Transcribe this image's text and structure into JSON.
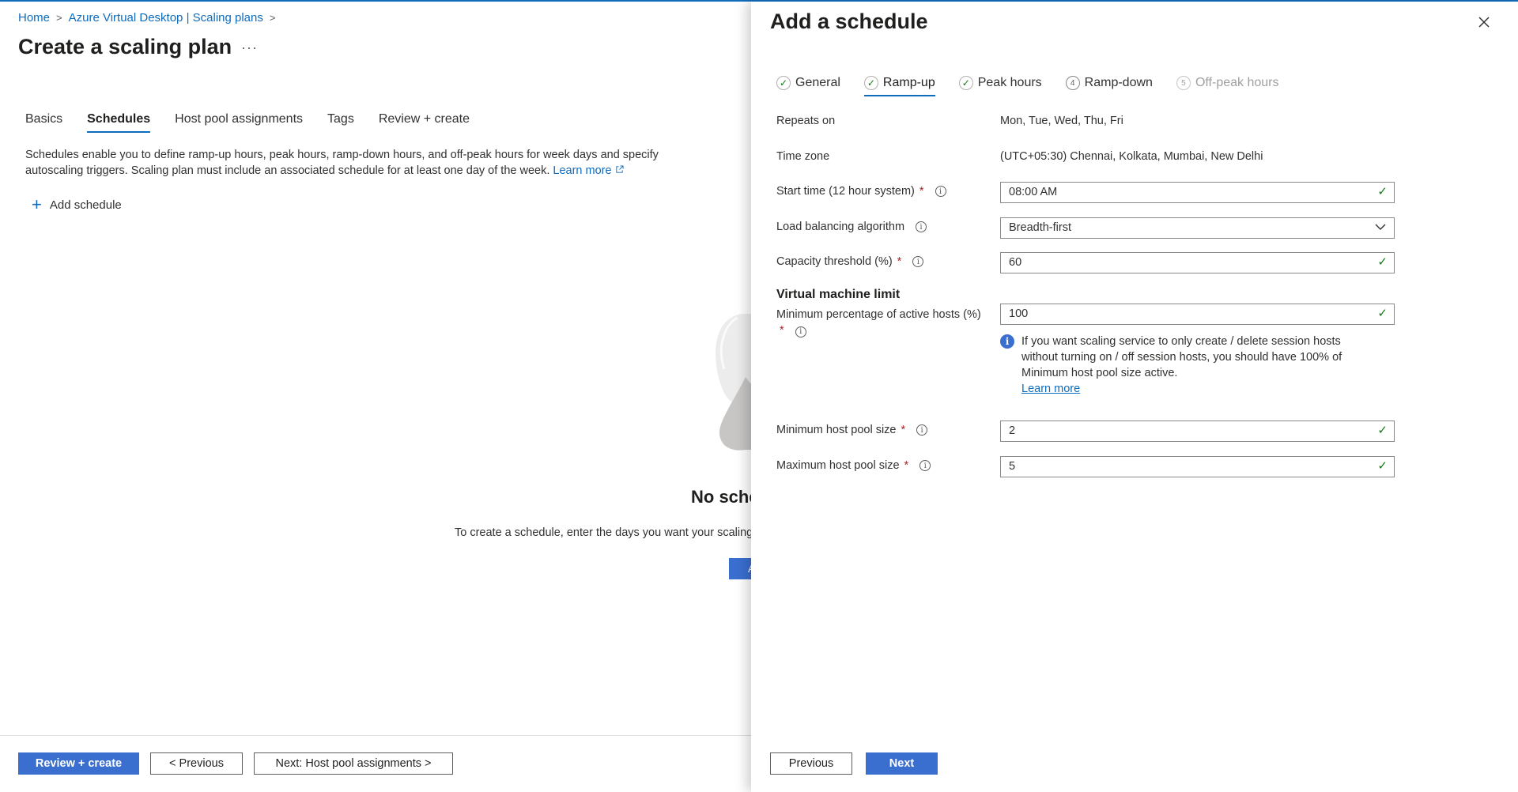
{
  "breadcrumb": {
    "home": "Home",
    "parent": "Azure Virtual Desktop | Scaling plans",
    "separator": ">"
  },
  "page": {
    "title": "Create a scaling plan",
    "more_label": "···",
    "tabs": [
      "Basics",
      "Schedules",
      "Host pool assignments",
      "Tags",
      "Review + create"
    ],
    "active_tab": "Schedules",
    "description": "Schedules enable you to define ramp-up hours, peak hours, ramp-down hours, and off-peak hours for week days and specify autoscaling triggers. Scaling plan must include an associated schedule for at least one day of the week.",
    "learn_more": "Learn more",
    "add_schedule": "Add schedule",
    "empty_title": "No sche",
    "empty_desc": "To create a schedule, enter the days you want your scaling",
    "empty_button": "A"
  },
  "footer": {
    "review_create": "Review + create",
    "previous": "< Previous",
    "next": "Next: Host pool assignments >"
  },
  "panel": {
    "title": "Add a schedule",
    "steps": [
      {
        "label": "General",
        "state": "done",
        "marker": "✓"
      },
      {
        "label": "Ramp-up",
        "state": "active",
        "marker": "✓"
      },
      {
        "label": "Peak hours",
        "state": "done",
        "marker": "✓"
      },
      {
        "label": "Ramp-down",
        "state": "todo",
        "marker": "4"
      },
      {
        "label": "Off-peak hours",
        "state": "disabled",
        "marker": "5"
      }
    ],
    "repeats_on_label": "Repeats on",
    "repeats_on_value": "Mon, Tue, Wed, Thu, Fri",
    "time_zone_label": "Time zone",
    "time_zone_value": "(UTC+05:30) Chennai, Kolkata, Mumbai, New Delhi",
    "start_time_label": "Start time (12 hour system)",
    "start_time_value": "08:00 AM",
    "load_balancing_label": "Load balancing algorithm",
    "load_balancing_value": "Breadth-first",
    "capacity_label": "Capacity threshold (%)",
    "capacity_value": "60",
    "vm_limit_heading": "Virtual machine limit",
    "min_active_label": "Minimum percentage of active hosts (%)",
    "min_active_value": "100",
    "info_note": "If you want scaling service to only create / delete session hosts without turning on / off session hosts, you should have 100% of Minimum host pool size active.",
    "info_learn_more": "Learn more",
    "min_pool_label": "Minimum host pool size",
    "min_pool_value": "2",
    "max_pool_label": "Maximum host pool size",
    "max_pool_value": "5",
    "required_mark": "*",
    "info_mark": "i",
    "check_mark": "✓",
    "previous": "Previous",
    "next": "Next"
  }
}
